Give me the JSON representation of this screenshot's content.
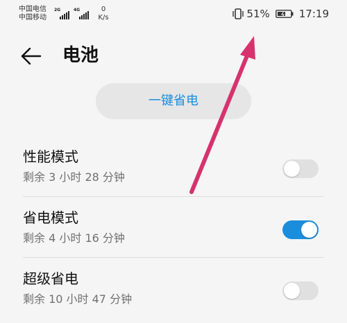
{
  "status_bar": {
    "carrier_1": "中国电信",
    "carrier_2": "中国移动",
    "signal_1_tag": "2G",
    "signal_2_tag": "4G",
    "net_speed_value": "0",
    "net_speed_unit": "K/s",
    "battery_percent": "51%",
    "time": "17:19"
  },
  "header": {
    "title": "电池"
  },
  "power_save_button": {
    "label": "一键省电"
  },
  "modes": [
    {
      "title": "性能模式",
      "remaining": "剩余 3 小时 28 分钟",
      "enabled": false
    },
    {
      "title": "省电模式",
      "remaining": "剩余 4 小时 16 分钟",
      "enabled": true
    },
    {
      "title": "超级省电",
      "remaining": "剩余 10 小时 47 分钟",
      "enabled": false
    }
  ],
  "colors": {
    "accent": "#1a8ddd",
    "annotation_arrow": "#d6336c",
    "toggle_off": "#e0e0e0"
  },
  "icons": {
    "back": "arrow-left-icon",
    "vibrate": "vibrate-icon",
    "battery": "battery-icon",
    "signal": "signal-bars-icon"
  }
}
